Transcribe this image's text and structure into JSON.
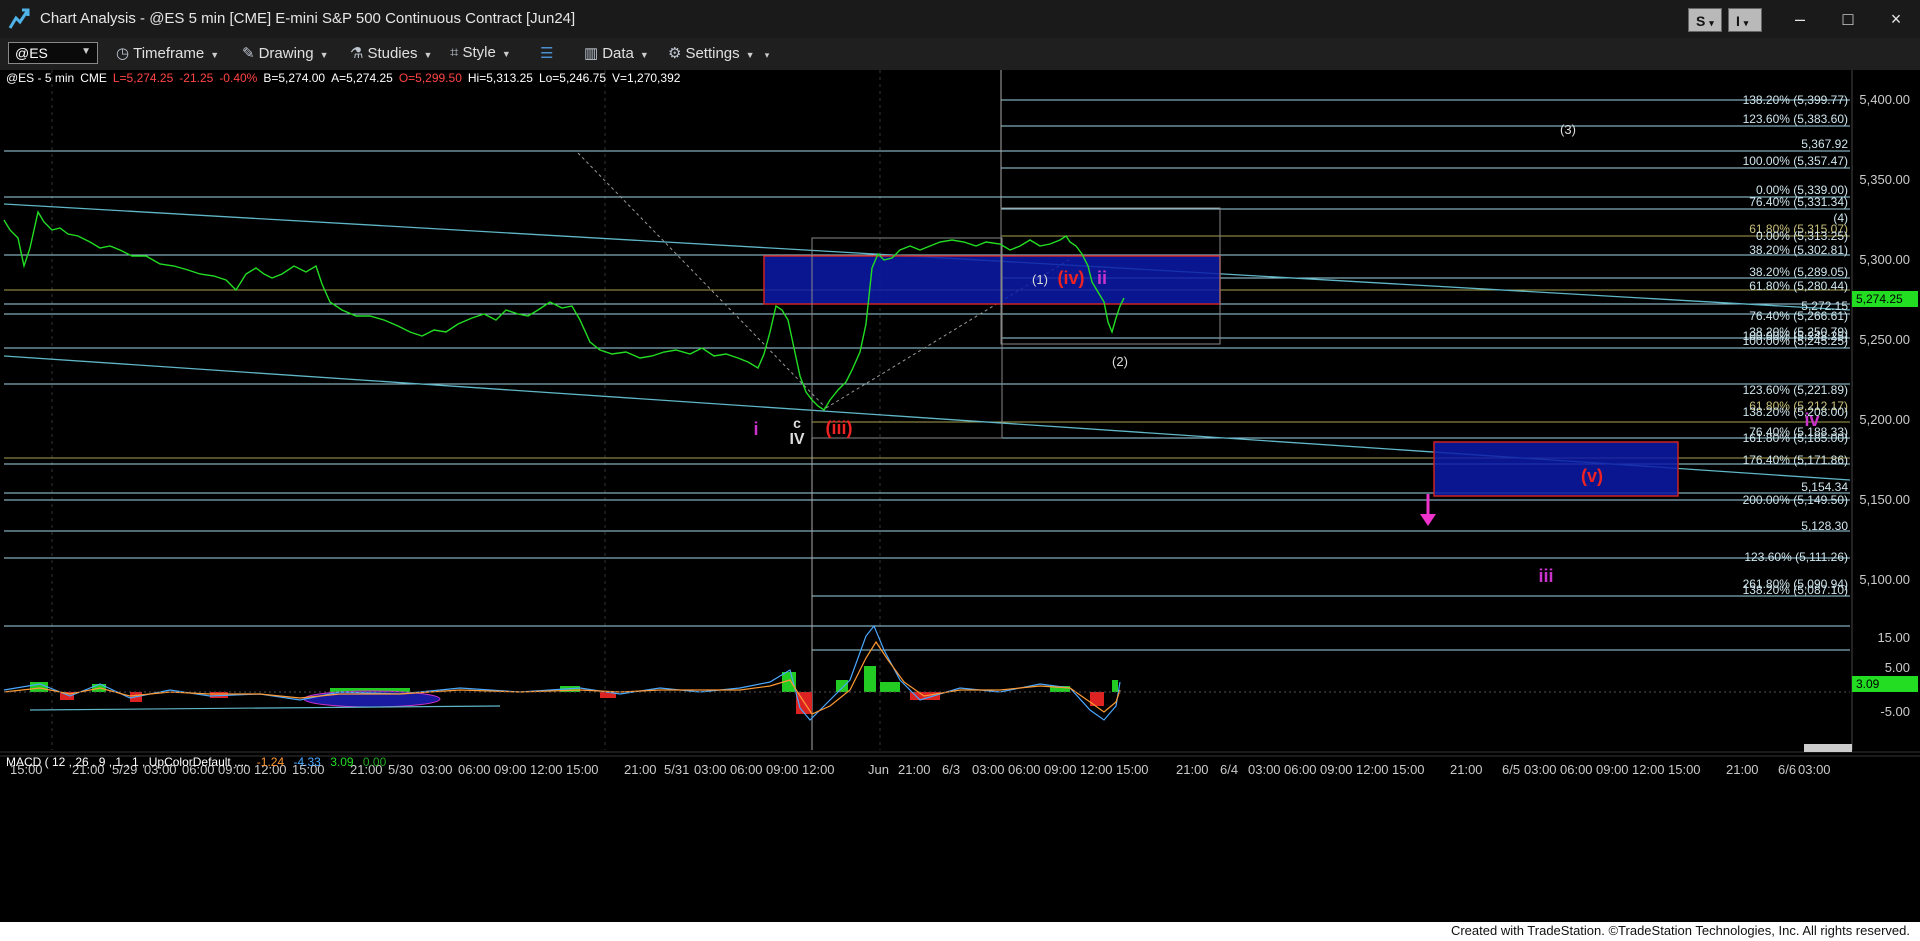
{
  "window": {
    "title": "Chart Analysis - @ES 5 min [CME] E-mini S&P 500 Continuous Contract [Jun24]",
    "buttons": {
      "s_button": "S",
      "i_button": "I",
      "minimize": "–",
      "maximize": "□",
      "close": "×"
    }
  },
  "toolbar": {
    "symbol": "@ES",
    "timeframe": "Timeframe",
    "drawing": "Drawing",
    "studies": "Studies",
    "style": "Style",
    "data": "Data",
    "settings": "Settings"
  },
  "status": {
    "symbol": "@ES - 5 min",
    "exchange": "CME",
    "last": "L=5,274.25",
    "change": "-21.25",
    "change_pct": "-0.40%",
    "bid": "B=5,274.00",
    "ask": "A=5,274.25",
    "open": "O=5,299.50",
    "high": "Hi=5,313.25",
    "low": "Lo=5,246.75",
    "volume": "V=1,270,392"
  },
  "colors": {
    "price": "#22dd22",
    "axis_text": "#cccccc",
    "fib_line": "#9fd6e6",
    "trendline": "#5fb6c6",
    "box_fill": "#0a1aa8",
    "box_border": "#cc2222",
    "wave_magenta": "#cc33cc",
    "wave_red": "#ee2222",
    "wave_white": "#dddddd",
    "neg_change": "#ff4444",
    "ask_color": "#44aaff",
    "price_badge": "#22dd22"
  },
  "price_axis": {
    "ticks": [
      "5,400.00",
      "5,350.00",
      "5,300.00",
      "5,250.00",
      "5,200.00",
      "5,150.00",
      "5,100.00"
    ],
    "current_price": "5,274.25"
  },
  "time_axis": {
    "ticks": [
      "15:00",
      "21:00",
      "5/29",
      "03:00",
      "06:00",
      "09:00",
      "12:00",
      "15:00",
      "21:00",
      "5/30",
      "03:00",
      "06:00",
      "09:00",
      "12:00",
      "15:00",
      "21:00",
      "5/31",
      "03:00",
      "06:00",
      "09:00",
      "12:00",
      "Jun",
      "21:00",
      "6/3",
      "03:00",
      "06:00",
      "09:00",
      "12:00",
      "15:00",
      "21:00",
      "6/4",
      "03:00",
      "06:00",
      "09:00",
      "12:00",
      "15:00",
      "21:00",
      "6/5",
      "03:00",
      "06:00",
      "09:00",
      "12:00",
      "15:00",
      "21:00",
      "6/6",
      "03:00"
    ]
  },
  "fib_labels": [
    "138.20% (5,399.77)",
    "123.60% (5,383.60)",
    "5,367.92",
    "100.00% (5,357.47)",
    "0.00% (5,339.00)",
    "76.40% (5,331.34)",
    "(4)",
    "61.80% (5,315.07)",
    "0.00% (5,313.25)",
    "38.20% (5,302.81)",
    "38.20% (5,289.05)",
    "61.80% (5,280.44)",
    "5,272.15",
    "76.40% (5,266.61)",
    "38.20% (5,250.79)",
    "100.00% (5,248.25)",
    "100.00% (5,245.25)",
    "123.60% (5,221.89)",
    "61.80% (5,212.17)",
    "138.20% (5,208.00)",
    "76.40% (5,188.33)",
    "161.80% (5,185.00)",
    "176.40% (5,171.86)",
    "5,154.34",
    "200.00% (5,149.50)",
    "5,128.30",
    "123.60% (5,111.26)",
    "261.80% (5,090.94)",
    "138.20% (5,087.10)"
  ],
  "wave_labels": {
    "w3": "(3)",
    "w1": "(1)",
    "wiv_red": "(iv)",
    "wii_mag": "ii",
    "w2": "(2)",
    "wi_mag": "i",
    "wc": "c",
    "wIV": "IV",
    "wiii_red": "(iii)",
    "wiv_mag": "iv",
    "wv_red": "(v)",
    "wiii_mag": "iii"
  },
  "macd": {
    "name": "MACD ( 12 , 26 , 9 , 1 , 1 , UpColorDefault ,...",
    "v1": "-1.24",
    "v2": "-4.33",
    "v3": "3.09",
    "v4": "0.00",
    "axis_ticks": [
      "15.00",
      "5.00",
      "-5.00"
    ],
    "current": "3.09"
  },
  "copyright": "Created with TradeStation. ©TradeStation Technologies, Inc. All rights reserved."
}
